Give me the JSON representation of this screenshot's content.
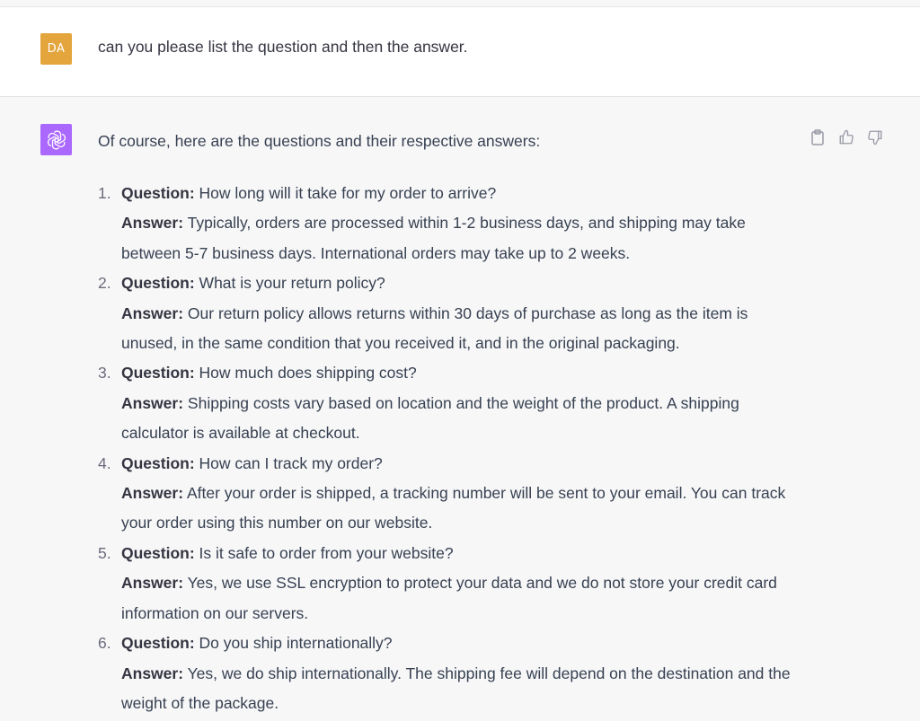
{
  "user_message": {
    "avatar_initials": "DA",
    "text": "can you please list the question and then the answer."
  },
  "assistant_message": {
    "intro": "Of course, here are the questions and their respective answers:",
    "question_label": "Question:",
    "answer_label": "Answer:",
    "actions": [
      "clipboard-icon",
      "thumbs-up-icon",
      "thumbs-down-icon"
    ],
    "items": [
      {
        "number": "1.",
        "question": "How long will it take for my order to arrive?",
        "answer": "Typically, orders are processed within 1-2 business days, and shipping may take between 5-7 business days. International orders may take up to 2 weeks."
      },
      {
        "number": "2.",
        "question": "What is your return policy?",
        "answer": "Our return policy allows returns within 30 days of purchase as long as the item is unused, in the same condition that you received it, and in the original packaging."
      },
      {
        "number": "3.",
        "question": "How much does shipping cost?",
        "answer": "Shipping costs vary based on location and the weight of the product. A shipping calculator is available at checkout."
      },
      {
        "number": "4.",
        "question": "How can I track my order?",
        "answer": "After your order is shipped, a tracking number will be sent to your email. You can track your order using this number on our website."
      },
      {
        "number": "5.",
        "question": "Is it safe to order from your website?",
        "answer": "Yes, we use SSL encryption to protect your data and we do not store your credit card information on our servers."
      },
      {
        "number": "6.",
        "question": "Do you ship internationally?",
        "answer": "Yes, we do ship internationally. The shipping fee will depend on the destination and the weight of the package."
      }
    ]
  },
  "colors": {
    "user_avatar": "#e3a53c",
    "bot_avatar": "#ab68ff",
    "user_bg": "#ffffff",
    "assistant_bg": "#f7f7f8"
  }
}
